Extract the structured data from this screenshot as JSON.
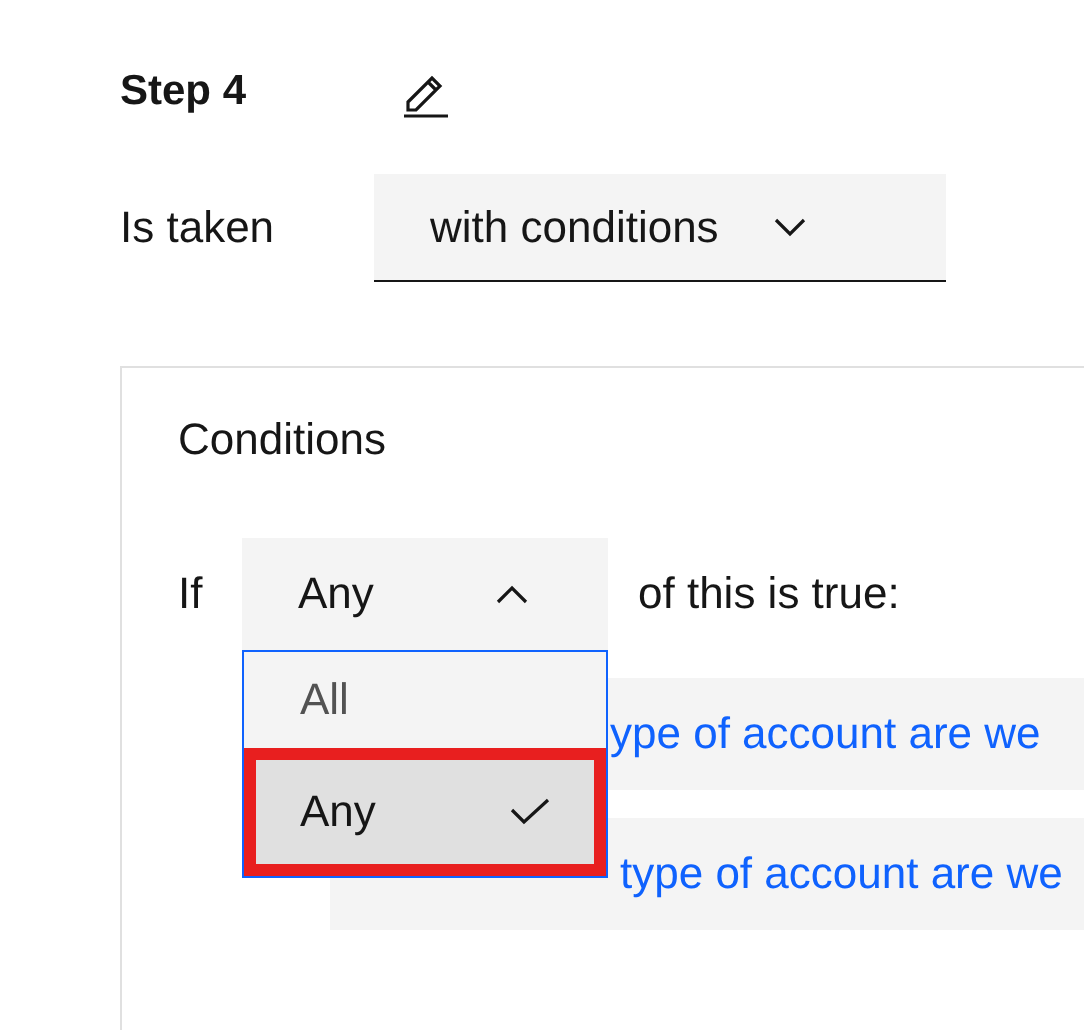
{
  "step": {
    "title": "Step 4"
  },
  "taken": {
    "label": "Is taken",
    "value": "with conditions"
  },
  "conditions": {
    "title": "Conditions",
    "if_label": "If",
    "quantifier": {
      "value": "Any",
      "expanded": true
    },
    "suffix": "of this is true:",
    "options": [
      {
        "label": "All",
        "selected": false
      },
      {
        "label": "Any",
        "selected": true
      }
    ],
    "rows": [
      {
        "text": "ype of account are we"
      },
      {
        "text": "type of account are we"
      }
    ]
  }
}
